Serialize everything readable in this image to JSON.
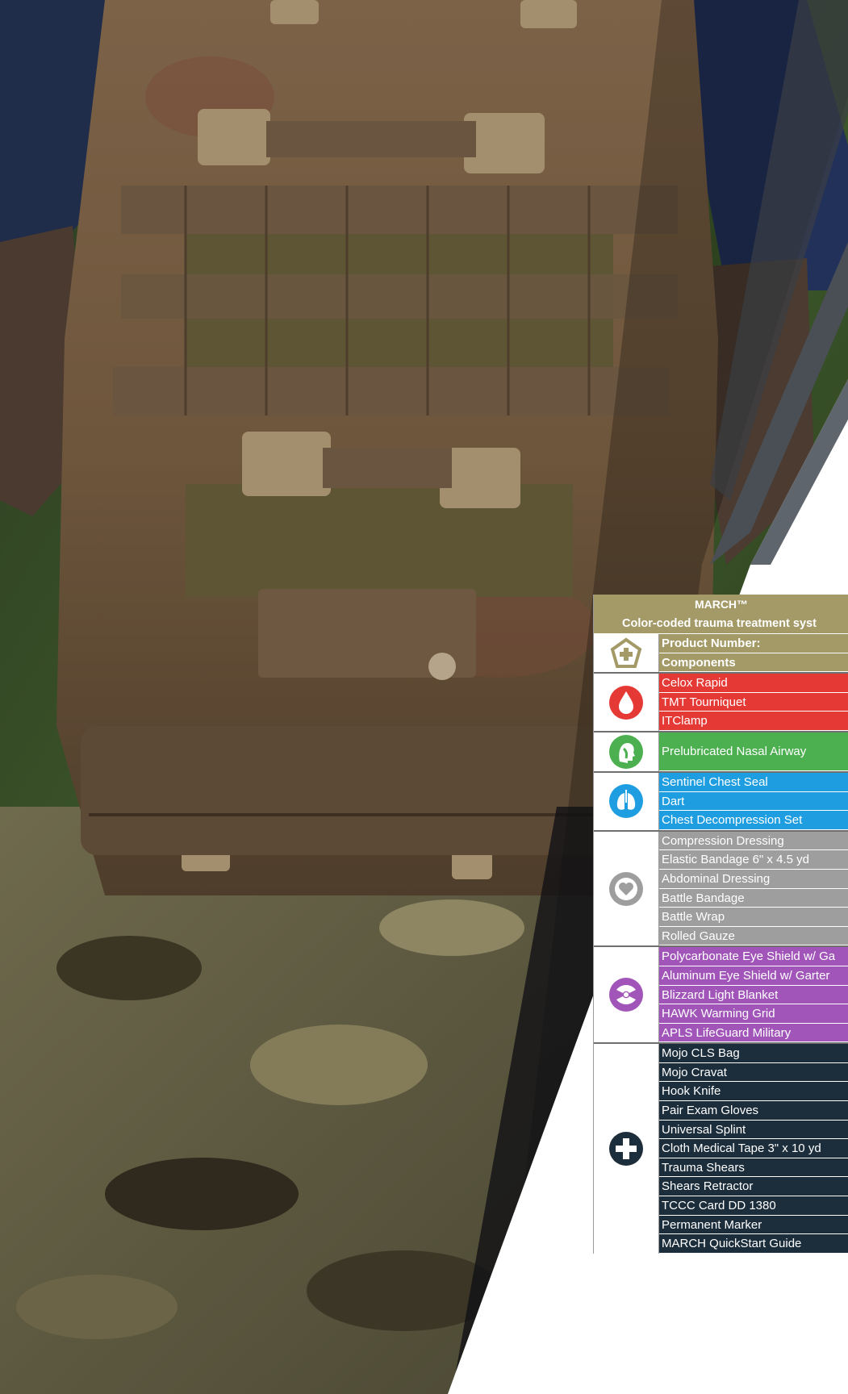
{
  "table": {
    "title": "MARCH™",
    "subtitle": "Color-coded trauma treatment syst",
    "groups": [
      {
        "key": "header",
        "icon": "pentagon-plus-icon",
        "color": "#a39a67",
        "rows": [
          "Product Number:",
          "Components"
        ]
      },
      {
        "key": "massive-hemorrhage",
        "icon": "blood-drop-icon",
        "color": "#e53935",
        "rows": [
          "Celox Rapid",
          "TMT Tourniquet",
          "ITClamp"
        ]
      },
      {
        "key": "airway",
        "icon": "airway-head-icon",
        "color": "#4caf50",
        "rows": [
          "Prelubricated Nasal Airway"
        ]
      },
      {
        "key": "respiration",
        "icon": "lungs-icon",
        "color": "#1e9ee0",
        "rows": [
          "Sentinel Chest Seal",
          "Dart",
          "Chest Decompression Set"
        ]
      },
      {
        "key": "circulation",
        "icon": "heart-circle-icon",
        "color": "#9e9e9e",
        "rows": [
          "Compression Dressing",
          "Elastic Bandage 6\" x 4.5 yd",
          "Abdominal Dressing",
          "Battle Bandage",
          "Battle Wrap",
          "Rolled Gauze"
        ]
      },
      {
        "key": "hypothermia-head",
        "icon": "head-eye-icon",
        "color": "#a155b9",
        "rows": [
          "Polycarbonate Eye Shield w/ Ga",
          "Aluminum Eye Shield w/ Garter",
          "Blizzard Light Blanket",
          "HAWK Warming Grid",
          "APLS LifeGuard Military"
        ]
      },
      {
        "key": "other",
        "icon": "medical-cross-icon",
        "color": "#1c2d3b",
        "rows": [
          "Mojo CLS Bag",
          "Mojo Cravat",
          "Hook Knife",
          "Pair Exam Gloves",
          "Universal Splint",
          "Cloth Medical Tape 3\" x 10 yd",
          "Trauma Shears",
          "Shears Retractor",
          "TCCC Card DD 1380",
          "Permanent Marker",
          "MARCH QuickStart Guide"
        ]
      }
    ]
  }
}
